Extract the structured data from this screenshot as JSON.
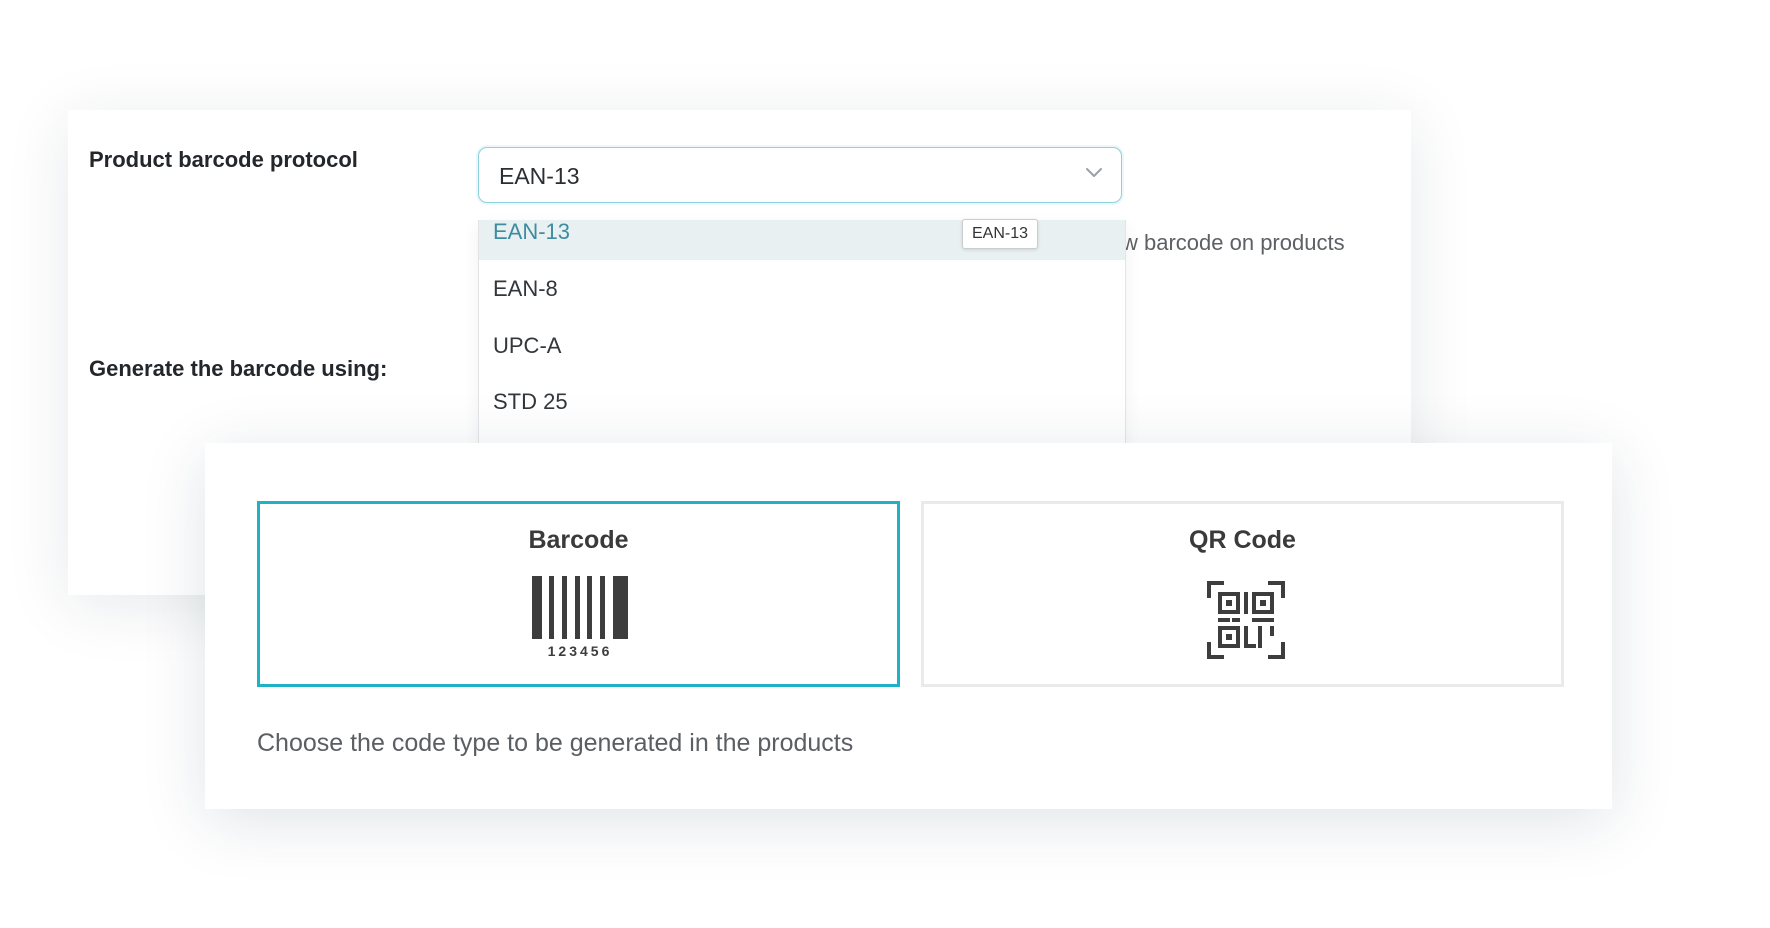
{
  "settings": {
    "protocol_label": "Product barcode protocol",
    "protocol_selected": "EAN-13",
    "hint_text": "w barcode on products",
    "generate_label": "Generate the barcode using:"
  },
  "dropdown": {
    "options": [
      "EAN-13",
      "EAN-8",
      "UPC-A",
      "STD 25"
    ],
    "highlighted": "EAN-13",
    "tooltip": "EAN-13"
  },
  "code_type": {
    "cards": [
      {
        "title": "Barcode",
        "icon": "barcode-icon",
        "icon_caption": "123456",
        "selected": true
      },
      {
        "title": "QR Code",
        "icon": "qr-code-icon",
        "selected": false
      }
    ],
    "description": "Choose the code type to be generated in the products"
  },
  "colors": {
    "accent": "#1fb1c4",
    "select_border": "#8ed0dc",
    "option_highlight_bg": "#e8f0f2",
    "option_highlight_text": "#3f8ca0",
    "icon": "#3d3d3d"
  }
}
